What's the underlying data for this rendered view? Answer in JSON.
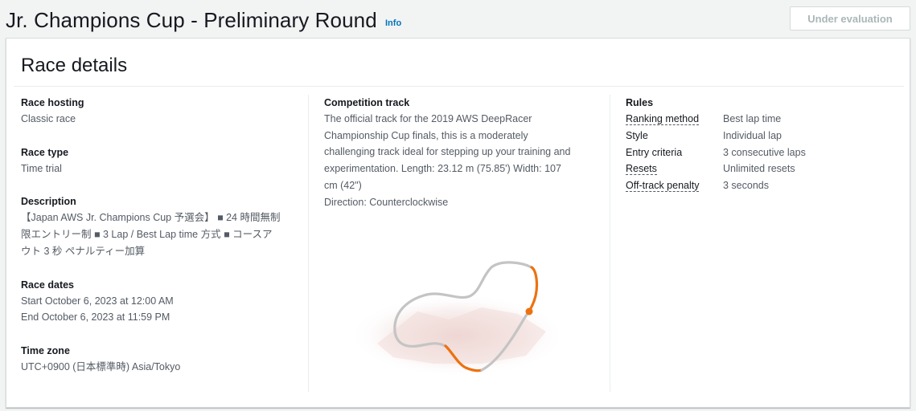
{
  "header": {
    "title": "Jr. Champions Cup - Preliminary Round",
    "info_label": "Info",
    "status_button_label": "Under evaluation"
  },
  "panel": {
    "title": "Race details",
    "race_hosting": {
      "label": "Race hosting",
      "value": "Classic race"
    },
    "race_type": {
      "label": "Race type",
      "value": "Time trial"
    },
    "description": {
      "label": "Description",
      "lines": [
        "【Japan AWS Jr. Champions Cup 予選会】 ■ 24 時間無制",
        "限エントリー制 ■ 3 Lap / Best Lap time 方式 ■ コースア",
        "ウト 3 秒 ペナルティー加算"
      ]
    },
    "race_dates": {
      "label": "Race dates",
      "start": "Start October 6, 2023 at 12:00 AM",
      "end": "End October 6, 2023 at 11:59 PM"
    },
    "time_zone": {
      "label": "Time zone",
      "value": "UTC+0900 (日本標準時) Asia/Tokyo"
    },
    "competition_track": {
      "label": "Competition track",
      "lines": [
        "The official track for the 2019 AWS DeepRacer",
        "Championship Cup finals, this is a moderately",
        "challenging track ideal for stepping up your training and",
        "experimentation. Length: 23.12 m (75.85') Width: 107",
        "cm (42\")",
        "Direction: Counterclockwise"
      ]
    },
    "rules": {
      "label": "Rules",
      "rows": [
        {
          "key": "Ranking method",
          "value": "Best lap time"
        },
        {
          "key": "Style",
          "value": "Individual lap"
        },
        {
          "key": "Entry criteria",
          "value": "3 consecutive laps"
        },
        {
          "key": "Resets",
          "value": "Unlimited resets"
        },
        {
          "key": "Off-track penalty",
          "value": "3 seconds"
        }
      ]
    }
  },
  "colors": {
    "accent_orange": "#ec7211",
    "track_gray": "#c4c4c4",
    "link_blue": "#0073bb"
  }
}
